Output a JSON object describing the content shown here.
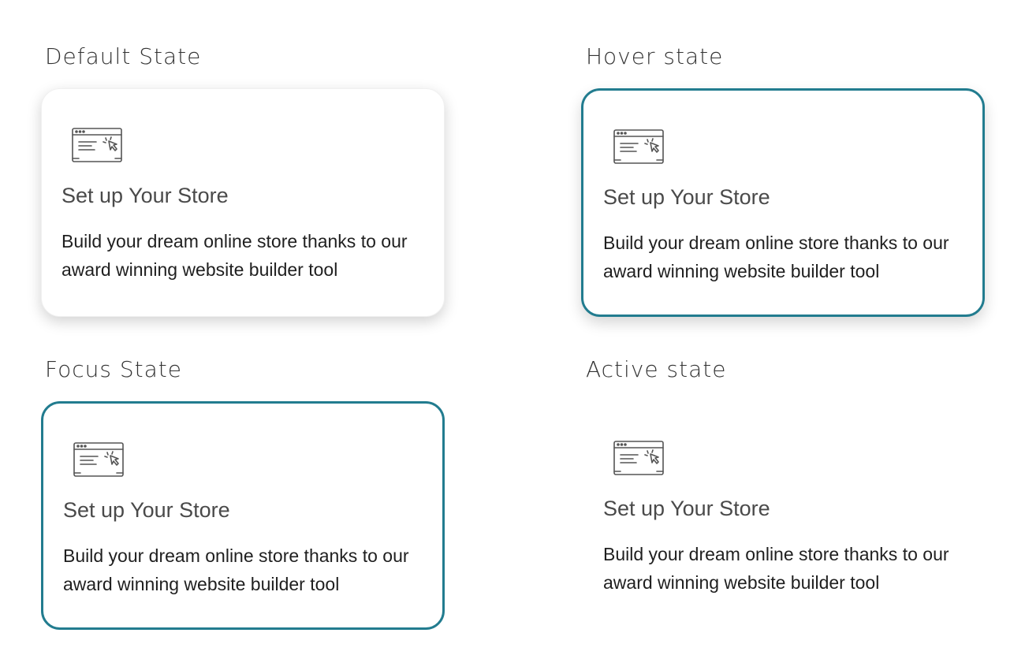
{
  "states": {
    "default": {
      "label": "Default State",
      "card": {
        "icon": "browser-window-cursor-icon",
        "title": "Set up Your Store",
        "description": "Build your dream online store thanks to our award winning website builder tool"
      }
    },
    "hover": {
      "label": "Hover state",
      "card": {
        "icon": "browser-window-cursor-icon",
        "title": "Set up Your Store",
        "description": "Build your dream online store thanks to our award winning website builder tool"
      }
    },
    "focus": {
      "label": "Focus State",
      "card": {
        "icon": "browser-window-cursor-icon",
        "title": "Set up Your Store",
        "description": "Build your dream online store thanks to our award winning website builder tool"
      }
    },
    "active": {
      "label": "Active state",
      "card": {
        "icon": "browser-window-cursor-icon",
        "title": "Set up Your Store",
        "description": "Build your dream online store thanks to our award winning website builder tool"
      }
    }
  },
  "colors": {
    "accent": "#227c8f",
    "heading_text": "#333333",
    "body_text": "#1f1f1f",
    "background": "#ffffff"
  }
}
